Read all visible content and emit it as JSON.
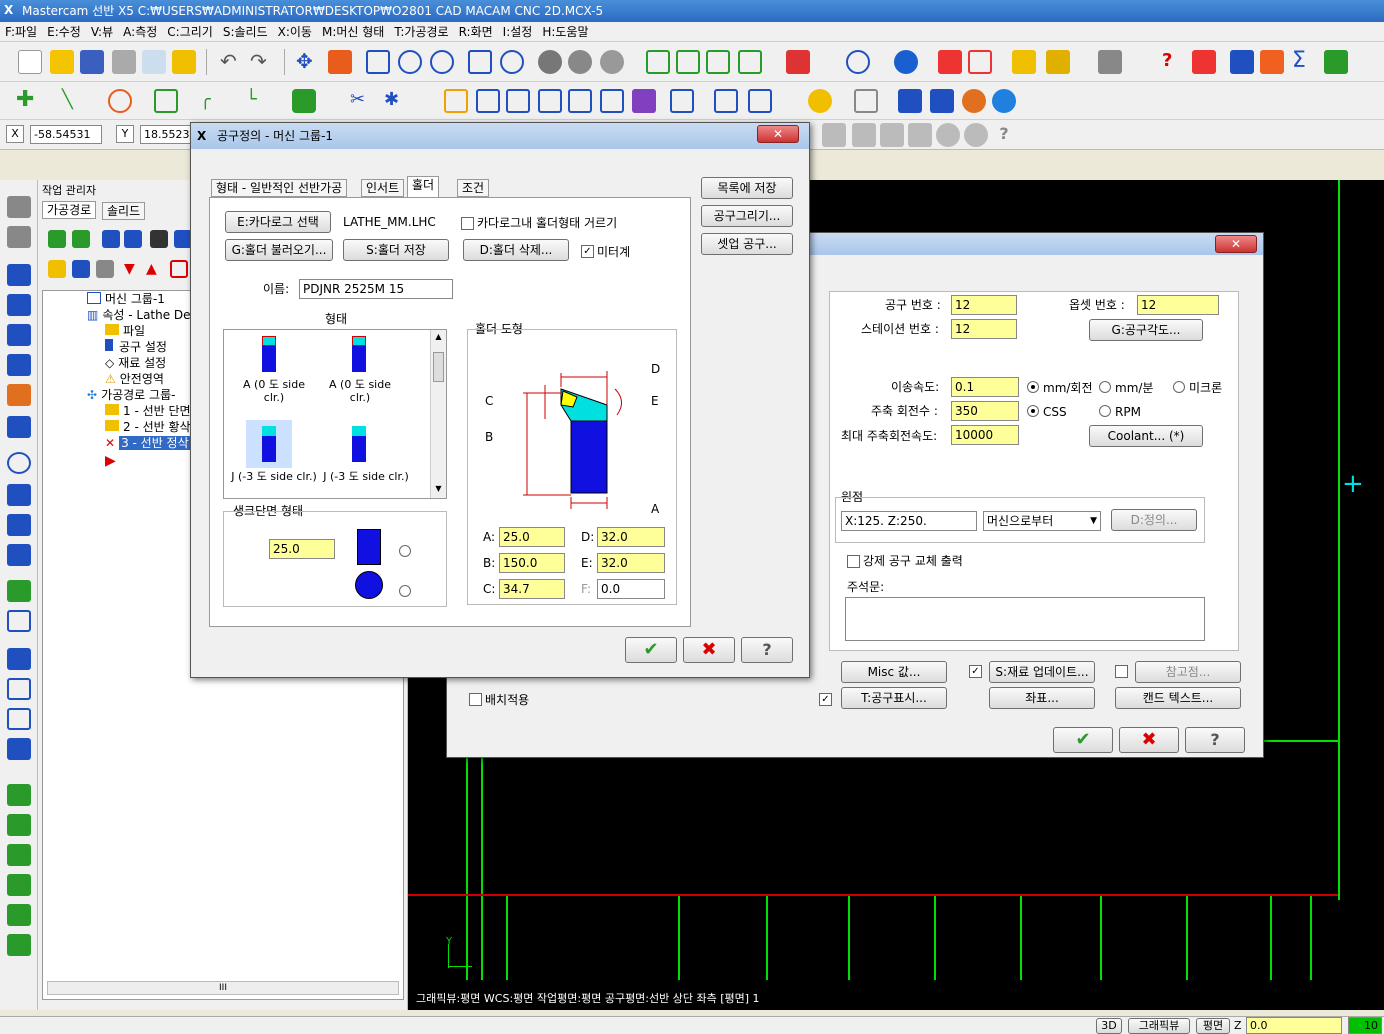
{
  "window": {
    "title": "Mastercam 선반 X5   C:₩USERS₩ADMINISTRATOR₩DESKTOP₩O2801 CAD MACAM CNC 2D.MCX-5"
  },
  "menu": [
    "F:파일",
    "E:수정",
    "V:뷰",
    "A:측정",
    "C:그리기",
    "S:솔리드",
    "X:이동",
    "M:머신 형태",
    "T:가공경로",
    "R:화면",
    "I:설정",
    "H:도움말"
  ],
  "coords": {
    "x_label": "X",
    "x_value": "-58.54531",
    "y_label": "Y",
    "y_value": "18.55237"
  },
  "opmgr": {
    "title": "작업 관리자",
    "tabs": [
      "가공경로",
      "솔리드"
    ],
    "tree": [
      {
        "label": "머신 그룹-1"
      },
      {
        "label": "속성 - Lathe De"
      },
      {
        "label": "파일"
      },
      {
        "label": "공구 설정"
      },
      {
        "label": "재료 설정"
      },
      {
        "label": "안전영역"
      },
      {
        "label": "가공경로 그룹-"
      },
      {
        "label": "1 - 선반 단면"
      },
      {
        "label": "2 - 선반 황삭"
      },
      {
        "label": "3 - 선반 정삭"
      }
    ],
    "scroll_label": "III"
  },
  "dialog1": {
    "title": "공구정의 - 머신 그룹-1",
    "tabs": [
      "형태 - 일반적인 선반가공",
      "인서트",
      "홀더",
      "조건"
    ],
    "side_buttons": [
      "목록에 저장",
      "공구그리기...",
      "셋업 공구..."
    ],
    "catalog_btn": "E:카다로그 선택",
    "catalog_file": "LATHE_MM.LHC",
    "filter_chk": "카다로그내 홀더형태 거르기",
    "load_btn": "G:홀더 불러오기...",
    "save_btn": "S:홀더 저장",
    "delete_btn": "D:홀더 삭제...",
    "metric_chk": "미터계",
    "name_label": "이름:",
    "name_value": "PDJNR 2525M 15",
    "style_label": "형태",
    "styles": [
      "A (0 도 side clr.)",
      "A (0 도 side clr.)",
      "J (-3 도 side clr.)",
      "J (-3 도 side clr.)"
    ],
    "geom_label": "홀더 도형",
    "geom_letters": [
      "D",
      "C",
      "E",
      "B",
      "A"
    ],
    "shank_label": "생크단면 형태",
    "shank_value": "25.0",
    "params": [
      {
        "label": "A:",
        "value": "25.0"
      },
      {
        "label": "D:",
        "value": "32.0"
      },
      {
        "label": "B:",
        "value": "150.0"
      },
      {
        "label": "E:",
        "value": "32.0"
      },
      {
        "label": "C:",
        "value": "34.7"
      },
      {
        "label": "F:",
        "value": "0.0"
      }
    ]
  },
  "dialog2": {
    "tool_no_label": "공구 번호 :",
    "tool_no": "12",
    "offset_label": "옵셋 번호 :",
    "offset_no": "12",
    "station_label": "스테이션 번호 :",
    "station_no": "12",
    "angle_btn": "G:공구각도...",
    "feed_label": "이송속도:",
    "feed": "0.1",
    "feed_units": [
      "mm/회전",
      "mm/분",
      "미크론"
    ],
    "spindle_label": "주축 회전수 :",
    "spindle": "350",
    "spindle_modes": [
      "CSS",
      "RPM"
    ],
    "max_label": "최대 주축회전속도:",
    "max_spindle": "10000",
    "coolant_btn": "Coolant... (*)",
    "home_label": "원점",
    "home_value": "X:125.  Z:250.",
    "home_select": "머신으로부터",
    "define_btn": "D:정의...",
    "force_chk": "강제 공구 교체 출력",
    "comment_label": "주석문:",
    "misc_btn": "Misc 값...",
    "stock_btn": "S:재료 업데이트...",
    "ref_btn": "참고점...",
    "batch_chk": "배치적용",
    "toolview_btn": "T:공구표시...",
    "coord_btn": "좌표...",
    "canned_btn": "캔드 텍스트..."
  },
  "canvas_status": "그래픽뷰:평면    WCS:평면    작업평면:평면    공구평면:선반 상단 좌측 [평면] 1",
  "status": {
    "mode": "3D",
    "gview": "그래픽뷰",
    "plane": "평면",
    "z_label": "Z",
    "z_value": "0.0",
    "level": "10"
  }
}
